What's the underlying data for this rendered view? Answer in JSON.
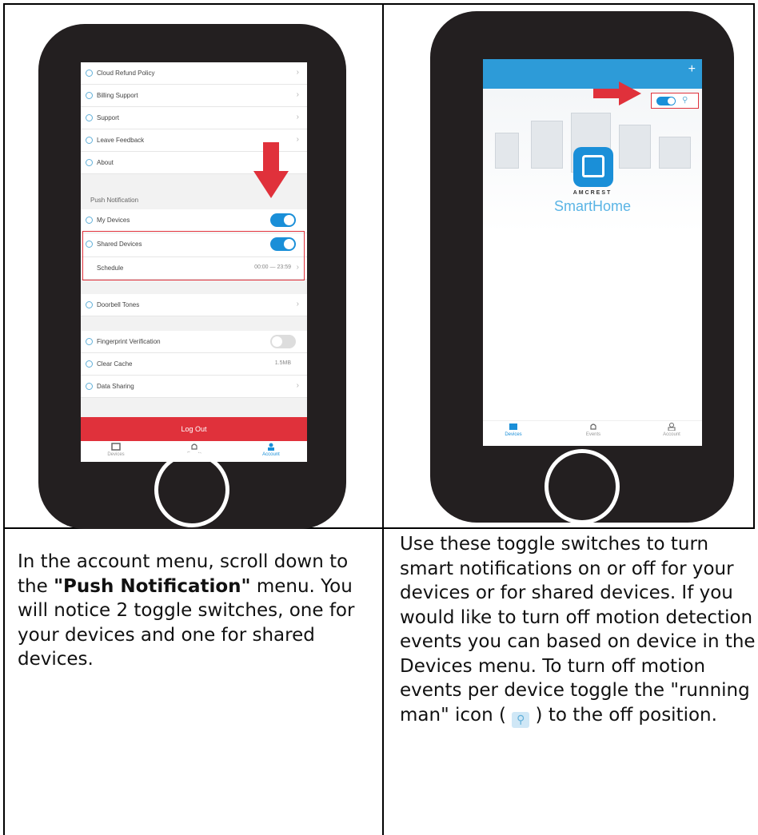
{
  "left_screen": {
    "rows_top": [
      {
        "label": "Cloud Refund Policy"
      },
      {
        "label": "Billing Support"
      },
      {
        "label": "Support"
      },
      {
        "label": "Leave Feedback"
      },
      {
        "label": "About"
      }
    ],
    "push_header": "Push Notification",
    "my_devices": "My Devices",
    "shared_devices": "Shared Devices",
    "schedule": "Schedule",
    "schedule_value": "00:00 — 23:59",
    "doorbell_tones": "Doorbell Tones",
    "fingerprint": "Fingerprint Verification",
    "clear_cache": "Clear Cache",
    "cache_value": "1.5MB",
    "data_sharing": "Data Sharing",
    "logout": "Log Out",
    "tabs": [
      "Devices",
      "Events",
      "Account"
    ]
  },
  "right_screen": {
    "plus": "+",
    "brand_small": "AMCREST",
    "brand_large": "SmartHome",
    "tabs": [
      "Devices",
      "Events",
      "Account"
    ]
  },
  "captions": {
    "left_before": "In the account menu, scroll down to the ",
    "left_bold": "\"Push Notification\"",
    "left_after": " menu. You will notice 2 toggle switches, one for your devices and one for shared devices.",
    "right_before": "Use these toggle switches to turn smart notifications on or off for your devices or for shared devices. If you would like to turn off motion detection events you can based on device in the Devices menu. To turn off motion events per device toggle the \"running man\" icon ( ",
    "right_after": " ) to the off position."
  },
  "colors": {
    "accent_blue": "#1a8fd8",
    "alert_red": "#e0313b",
    "phone_body": "#231f20"
  }
}
